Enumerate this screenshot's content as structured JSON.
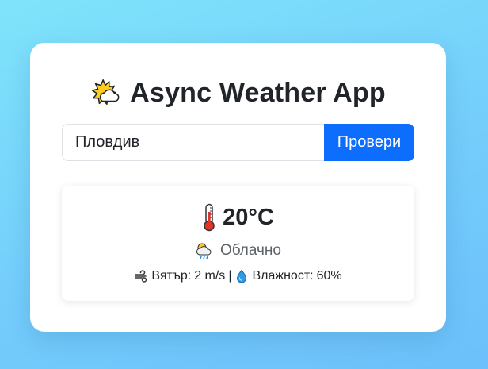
{
  "app": {
    "title": "Async Weather App"
  },
  "search": {
    "value": "Пловдив",
    "button_label": "Провери"
  },
  "weather": {
    "temperature": "20°C",
    "description": "Облачно",
    "wind_label": "Вятър:",
    "wind_value": "2 m/s",
    "separator": "|",
    "humidity_label": "Влажност:",
    "humidity_value": "60%"
  },
  "icons": {
    "title": "sun-behind-cloud-icon",
    "temperature": "thermometer-icon",
    "description": "cloud-with-rain-icon",
    "wind": "wind-icon",
    "humidity": "droplet-icon"
  },
  "colors": {
    "accent": "#0d6efd",
    "background_top": "#7fe4fb",
    "background_bottom": "#6cc0fb"
  }
}
